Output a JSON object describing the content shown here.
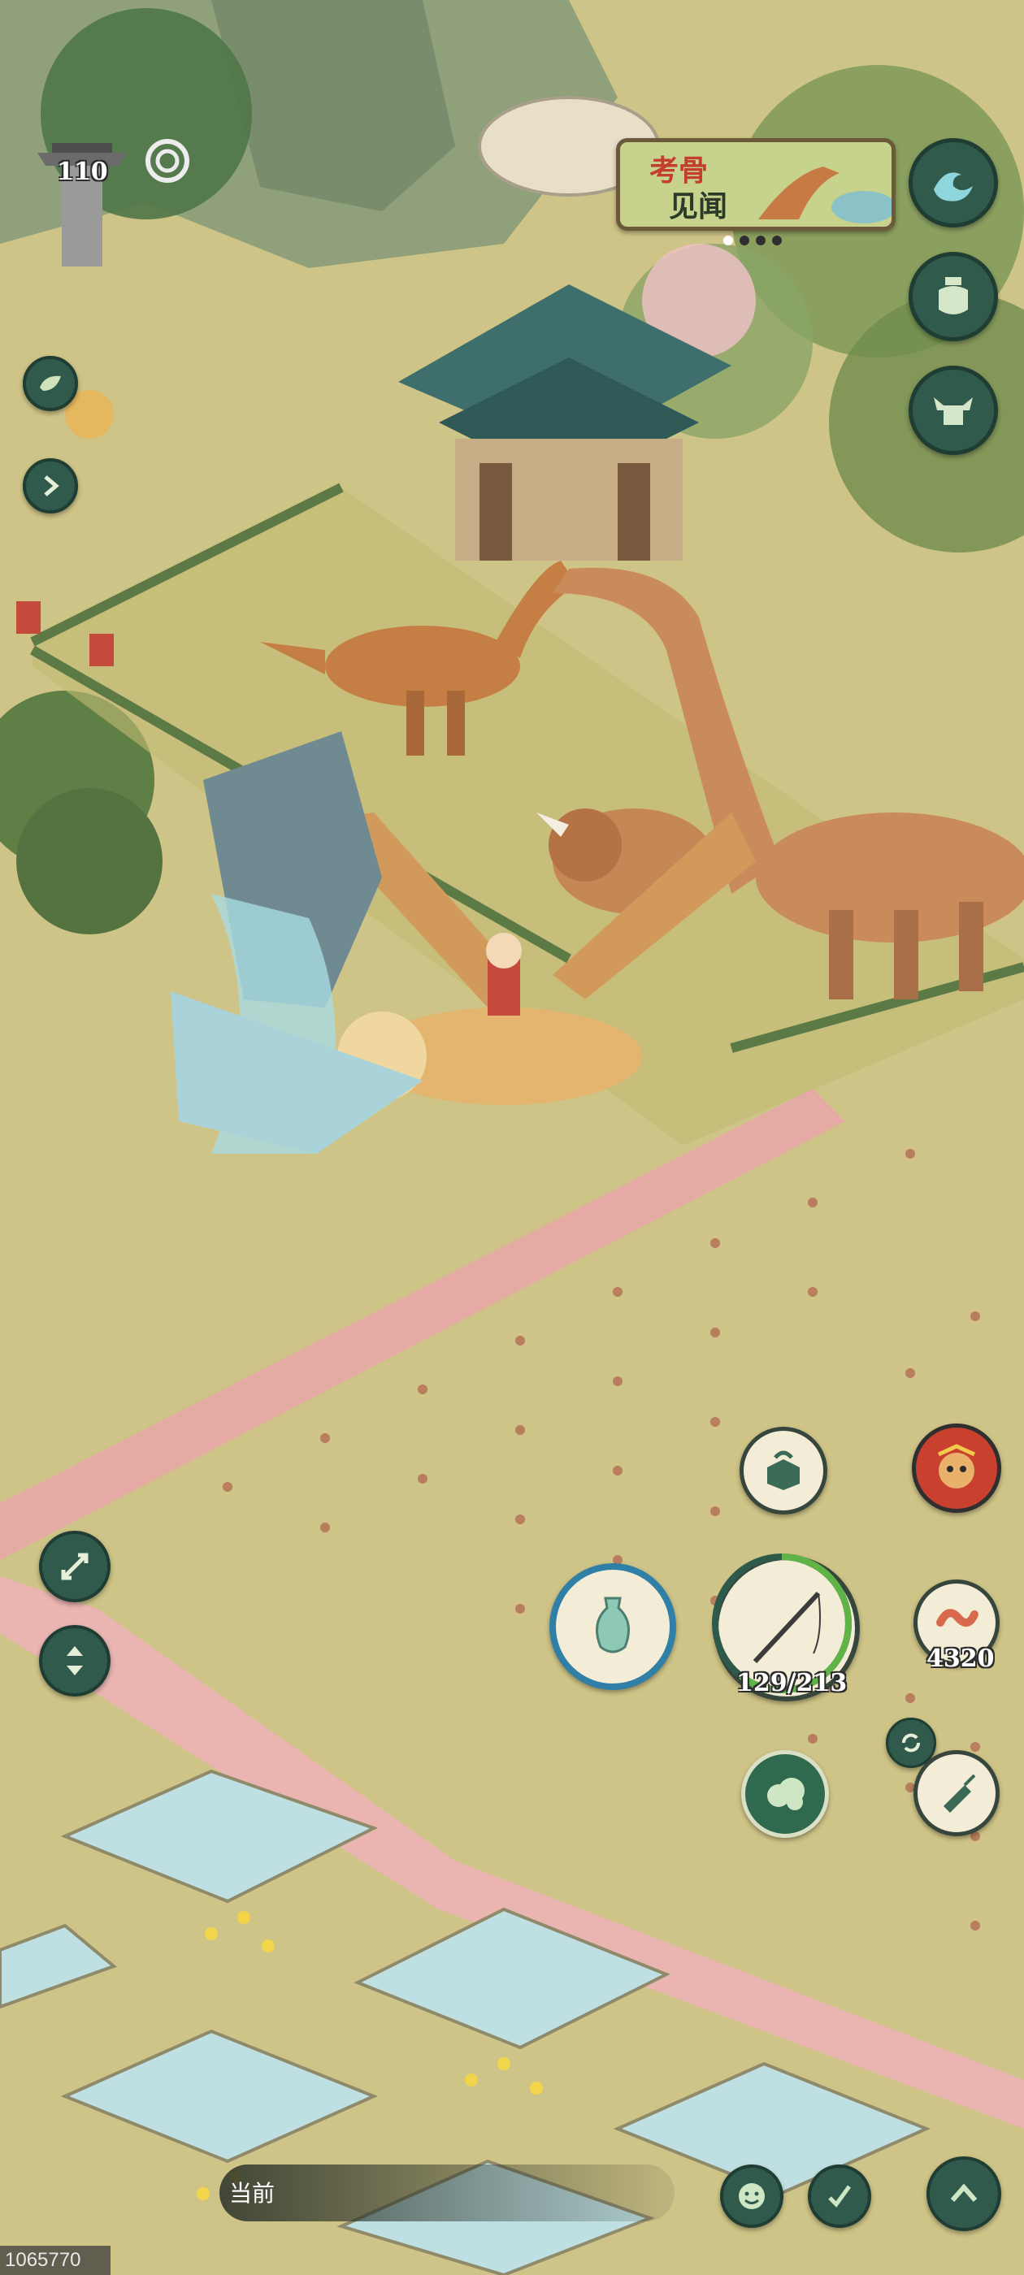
{
  "player": {
    "level": "110"
  },
  "event_banner": {
    "line1": "考骨",
    "line2": "见闻"
  },
  "energy": {
    "value": "129/213",
    "fraction": 0.606
  },
  "currency": {
    "amount": "4320",
    "icon": "worm-icon"
  },
  "chat": {
    "label": "当前"
  },
  "image_id_text": "1065770",
  "colors": {
    "button_dark": "#2f5a4c",
    "button_border": "#1f3d33",
    "grass": "#c9c07f",
    "water": "#bfe0e2"
  },
  "right_menu_icons": [
    "wave-icon",
    "jar-icon",
    "ox-head-icon"
  ],
  "left_menu_icons": [
    "leaf-icon",
    "arrow-right-icon"
  ],
  "tool_icons": [
    "box-icon",
    "monkey-king-avatar",
    "vase-icon",
    "fishing-rod-icon",
    "cloud-icon",
    "planting-icon",
    "refresh-icon"
  ],
  "bottom_icons": [
    "emote-icon",
    "edit-icon",
    "chevron-up-icon"
  ]
}
